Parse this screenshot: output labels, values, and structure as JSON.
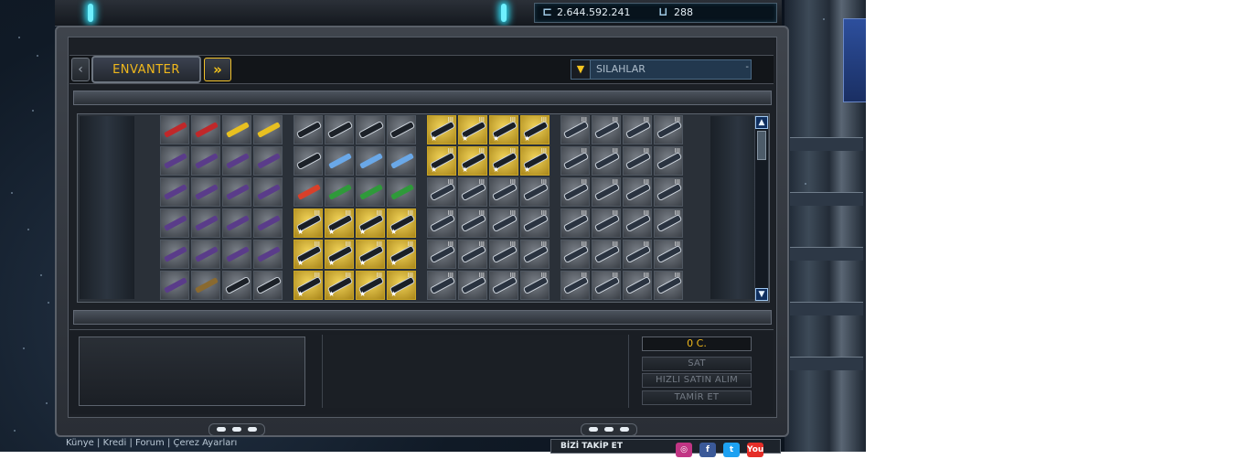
{
  "wallet": {
    "credits_icon": "credits-icon",
    "credits": "2.644.592.241",
    "uridium_icon": "uridium-icon",
    "uridium": "288"
  },
  "tabs": {
    "prev_icon": "chevron-left-icon",
    "current": "ENVANTER",
    "next_icon": "double-chevron-right-icon"
  },
  "filter": {
    "icon": "filter-arrow-icon",
    "selected": "SILAHLAR"
  },
  "scroll": {
    "up_icon": "chevron-up-icon",
    "down_icon": "chevron-down-icon"
  },
  "inventory": {
    "columns": 4,
    "rows": 6,
    "groups": [
      {
        "items": [
          {
            "k": "red"
          },
          {
            "k": "red"
          },
          {
            "k": "yellow"
          },
          {
            "k": "yellow"
          },
          {
            "k": "purple"
          },
          {
            "k": "purple"
          },
          {
            "k": "purple"
          },
          {
            "k": "purple"
          },
          {
            "k": "purple"
          },
          {
            "k": "purple"
          },
          {
            "k": "purple"
          },
          {
            "k": "purple"
          },
          {
            "k": "purple"
          },
          {
            "k": "purple"
          },
          {
            "k": "purple"
          },
          {
            "k": "purple"
          },
          {
            "k": "purple"
          },
          {
            "k": "purple"
          },
          {
            "k": "purple"
          },
          {
            "k": "purple"
          },
          {
            "k": "purple"
          },
          {
            "k": "brown"
          },
          {
            "k": "dark"
          },
          {
            "k": "dark"
          }
        ]
      },
      {
        "items": [
          {
            "k": "dark"
          },
          {
            "k": "dark"
          },
          {
            "k": "dark"
          },
          {
            "k": "dark"
          },
          {
            "k": "dark"
          },
          {
            "k": "blue"
          },
          {
            "k": "blue"
          },
          {
            "k": "blue"
          },
          {
            "k": "red2"
          },
          {
            "k": "green"
          },
          {
            "k": "green"
          },
          {
            "k": "green"
          },
          {
            "k": "goldgun",
            "lv": "III",
            "star": "★"
          },
          {
            "k": "goldgun",
            "lv": "III",
            "star": "★"
          },
          {
            "k": "goldgun",
            "lv": "III",
            "star": "★"
          },
          {
            "k": "goldgun",
            "lv": "III",
            "star": "★"
          },
          {
            "k": "goldgun",
            "lv": "III",
            "star": "★"
          },
          {
            "k": "goldgun",
            "lv": "III",
            "star": "★"
          },
          {
            "k": "goldgun",
            "lv": "III",
            "star": "★"
          },
          {
            "k": "goldgun",
            "lv": "III",
            "star": "★"
          },
          {
            "k": "goldgun",
            "lv": "III",
            "star": "★"
          },
          {
            "k": "goldgun",
            "lv": "III",
            "star": "★"
          },
          {
            "k": "goldgun",
            "lv": "III",
            "star": "★"
          },
          {
            "k": "goldgun",
            "lv": "III",
            "star": "★"
          }
        ]
      },
      {
        "items": [
          {
            "k": "goldgun",
            "lv": "III",
            "star": "★"
          },
          {
            "k": "goldgun",
            "lv": "III",
            "star": "★"
          },
          {
            "k": "goldgun",
            "lv": "III",
            "star": "★"
          },
          {
            "k": "goldgun",
            "lv": "III",
            "star": "★"
          },
          {
            "k": "goldgun",
            "lv": "III",
            "star": "★"
          },
          {
            "k": "goldgun",
            "lv": "III",
            "star": "★"
          },
          {
            "k": "goldgun",
            "lv": "III",
            "star": "★"
          },
          {
            "k": "goldgun",
            "lv": "III",
            "star": "★"
          },
          {
            "k": "silver",
            "lv": "III"
          },
          {
            "k": "silver",
            "lv": "III"
          },
          {
            "k": "silver",
            "lv": "III"
          },
          {
            "k": "silver",
            "lv": "III"
          },
          {
            "k": "silver",
            "lv": "III"
          },
          {
            "k": "silver",
            "lv": "III"
          },
          {
            "k": "silver",
            "lv": "III"
          },
          {
            "k": "silver",
            "lv": "III"
          },
          {
            "k": "silver",
            "lv": "III"
          },
          {
            "k": "silver",
            "lv": "III"
          },
          {
            "k": "silver",
            "lv": "III"
          },
          {
            "k": "silver",
            "lv": "III"
          },
          {
            "k": "silver",
            "lv": "III"
          },
          {
            "k": "silver",
            "lv": "III"
          },
          {
            "k": "silver",
            "lv": "III"
          },
          {
            "k": "silver",
            "lv": "III"
          }
        ]
      },
      {
        "items": [
          {
            "k": "silver",
            "lv": "III"
          },
          {
            "k": "silver",
            "lv": "III"
          },
          {
            "k": "silver",
            "lv": "III"
          },
          {
            "k": "silver",
            "lv": "III"
          },
          {
            "k": "silver",
            "lv": "III"
          },
          {
            "k": "silver",
            "lv": "III"
          },
          {
            "k": "silver",
            "lv": "III"
          },
          {
            "k": "silver",
            "lv": "III"
          },
          {
            "k": "silver",
            "lv": "III"
          },
          {
            "k": "silver",
            "lv": "III"
          },
          {
            "k": "silver",
            "lv": "III"
          },
          {
            "k": "silver",
            "lv": "III"
          },
          {
            "k": "silver",
            "lv": "III"
          },
          {
            "k": "silver",
            "lv": "III"
          },
          {
            "k": "silver",
            "lv": "III"
          },
          {
            "k": "silver",
            "lv": "III"
          },
          {
            "k": "silver",
            "lv": "III"
          },
          {
            "k": "silver",
            "lv": "III"
          },
          {
            "k": "silver",
            "lv": "III"
          },
          {
            "k": "silver",
            "lv": "III"
          },
          {
            "k": "silver",
            "lv": "III"
          },
          {
            "k": "silver",
            "lv": "III"
          },
          {
            "k": "silver",
            "lv": "III"
          },
          {
            "k": "silver",
            "lv": "III"
          }
        ]
      }
    ],
    "item_colors": {
      "red": "#c0282a",
      "yellow": "#e8c020",
      "purple": "#5a3c8a",
      "brown": "#8a6a30",
      "dark": "#1c2128",
      "blue": "#6aa8e8",
      "red2": "#d8402a",
      "green": "#2f9a3a",
      "goldgun": "#1a1f26",
      "silver": "#2a3340"
    }
  },
  "actions": {
    "price": "0 C.",
    "sell": "SAT",
    "quick_buy": "HIZLI SATIN ALIM",
    "repair": "TAMİR ET"
  },
  "footer": {
    "links": [
      "Künye",
      "Kredi",
      "Forum",
      "Çerez Ayarları"
    ],
    "separator": "|",
    "follow_label": "BİZİ TAKİP ET",
    "social_icons": [
      "instagram-icon",
      "facebook-icon",
      "twitter-icon",
      "youtube-icon"
    ],
    "social_glyphs": [
      "◎",
      "f",
      "t",
      "You"
    ],
    "social_colors": [
      "#c13584",
      "#3b5998",
      "#1da1f2",
      "#e52d27"
    ]
  }
}
